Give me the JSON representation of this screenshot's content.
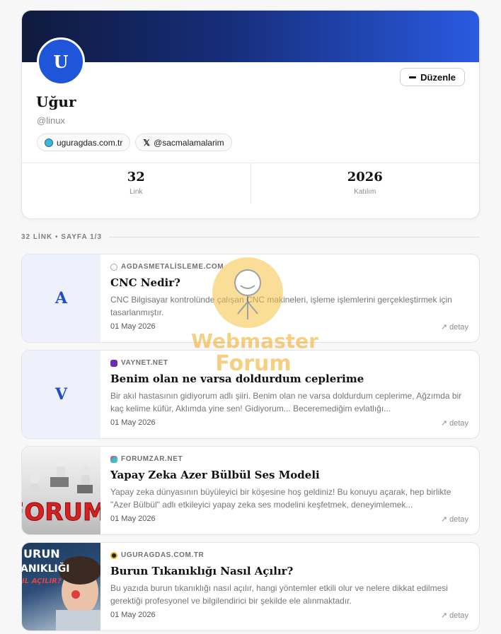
{
  "profile": {
    "avatar_letter": "U",
    "name": "Uğur",
    "handle": "@linux",
    "edit_label": "Düzenle",
    "links": [
      {
        "icon": "globe-icon",
        "label": "uguragdas.com.tr"
      },
      {
        "icon": "x-icon",
        "glyph": "𝕏",
        "label": "@sacmalamalarim"
      }
    ],
    "stats": [
      {
        "value": "32",
        "label": "Link"
      },
      {
        "value": "2026",
        "label": "Katılım"
      }
    ]
  },
  "section": {
    "title": "32 LİNK • SAYFA 1/3"
  },
  "cards": [
    {
      "thumb_letter": "A",
      "domain": "AGDASMETALİSLEME.COM",
      "title": "CNC Nedir?",
      "desc": "CNC Bilgisayar kontrolünde çalışan CNC makineleri, işleme işlemlerini gerçekleştirmek için tasarlanmıştır.",
      "date": "01 May 2026",
      "detail": "↗ detay"
    },
    {
      "thumb_letter": "V",
      "domain": "VAYNET.NET",
      "title": "Benim olan ne varsa doldurdum ceplerime",
      "desc": "Bir akıl hastasının gidiyorum adlı şiiri. Benim olan ne varsa doldurdum ceplerime, Ağzımda bir kaç kelime küfür, Aklımda yine sen! Gidiyorum... Beceremediğim evlatlığı...",
      "date": "01 May 2026",
      "detail": "↗ detay"
    },
    {
      "thumb_text": "FORUM",
      "domain": "FORUMZAR.NET",
      "title": "Yapay Zeka Azer Bülbül Ses Modeli",
      "desc": "Yapay zeka dünyasının büyüleyici bir köşesine hoş geldiniz! Bu konuyu açarak, hep birlikte \"Azer Bülbül\" adlı etkileyici yapay zeka ses modelini keşfetmek, deneyimlemek...",
      "date": "01 May 2026",
      "detail": "↗ detay"
    },
    {
      "thumb_text_1": "URUN",
      "thumb_text_2": "ANIKLIĞI",
      "thumb_text_3": "IL AÇILIR?",
      "domain": "UGURAGDAS.COM.TR",
      "title": "Burun Tıkanıklığı Nasıl Açılır?",
      "desc": "Bu yazıda burun tıkanıklığı nasıl açılır, hangi yöntemler etkili olur ve nelere dikkat edilmesi gerektiği profesyonel ve bilgilendirici bir şekilde ele alınmaktadır.",
      "date": "01 May 2026",
      "detail": "↗ detay"
    }
  ],
  "watermark": {
    "line1": "Webmaster",
    "line2": "Forum"
  },
  "colors": {
    "accent": "#1f55d8",
    "banner_dark": "#0f1a3d",
    "letter_thumb_bg": "#eef1fb"
  }
}
